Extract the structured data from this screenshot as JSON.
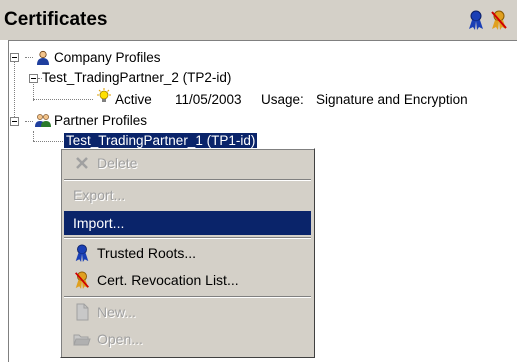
{
  "header": {
    "title": "Certificates"
  },
  "tree": {
    "company_profiles": "Company Profiles",
    "trading_partner_2": "Test_TradingPartner_2 (TP2-id)",
    "cert_status": "Active",
    "cert_date": "11/05/2003",
    "cert_usage_label": "Usage:",
    "cert_usage_value": "Signature and Encryption",
    "partner_profiles": "Partner Profiles",
    "trading_partner_1": "Test_TradingPartner_1 (TP1-id)"
  },
  "context_menu": {
    "delete": "Delete",
    "export": "Export...",
    "import": "Import...",
    "trusted_roots": "Trusted Roots...",
    "revocation_list": "Cert. Revocation List...",
    "new": "New...",
    "open": "Open..."
  },
  "colors": {
    "highlight": "#0a246a",
    "menu_bg": "#d4d0c8",
    "selection_outline": "#ffff00"
  }
}
